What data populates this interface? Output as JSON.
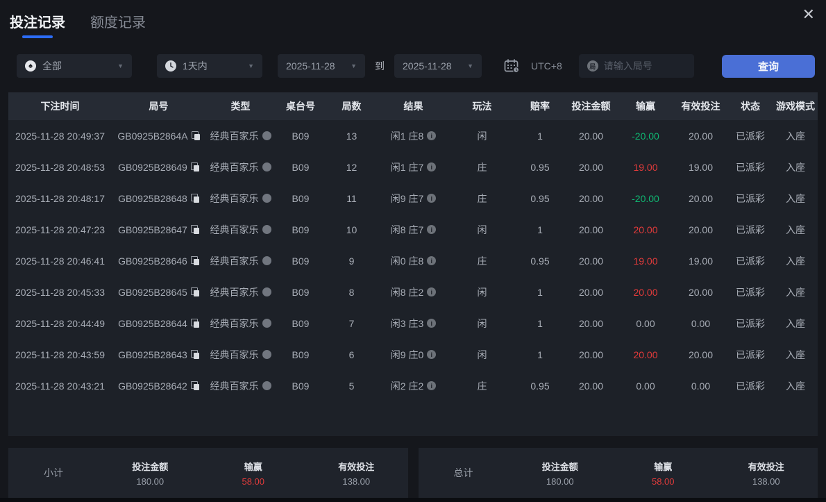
{
  "window": {
    "close_glyph": "✕"
  },
  "tabs": [
    {
      "label": "投注记录",
      "active": true
    },
    {
      "label": "额度记录",
      "active": false
    }
  ],
  "filters": {
    "game_type": "全部",
    "time_range": "1天内",
    "date_from": "2025-11-28",
    "to_label": "到",
    "date_to": "2025-11-28",
    "timezone": "UTC+8",
    "round_input_placeholder": "请输入局号",
    "round_badge_glyph": "局",
    "search_label": "查询",
    "caret_glyph": "▼",
    "spade_glyph": "♠"
  },
  "table": {
    "columns": [
      "下注时间",
      "局号",
      "类型",
      "桌台号",
      "局数",
      "结果",
      "玩法",
      "赔率",
      "投注金额",
      "输赢",
      "有效投注",
      "状态",
      "游戏模式"
    ],
    "info_glyph": "i",
    "rows": [
      {
        "time": "2025-11-28 20:49:37",
        "round_id": "GB0925B2864A",
        "type": "经典百家乐",
        "table_no": "B09",
        "round_no": "13",
        "result": "闲1 庄8",
        "play": "闲",
        "odds": "1",
        "bet": "20.00",
        "winloss": "-20.00",
        "winloss_color": "green",
        "valid": "20.00",
        "status": "已派彩",
        "mode": "入座"
      },
      {
        "time": "2025-11-28 20:48:53",
        "round_id": "GB0925B28649",
        "type": "经典百家乐",
        "table_no": "B09",
        "round_no": "12",
        "result": "闲1 庄7",
        "play": "庄",
        "odds": "0.95",
        "bet": "20.00",
        "winloss": "19.00",
        "winloss_color": "red",
        "valid": "19.00",
        "status": "已派彩",
        "mode": "入座"
      },
      {
        "time": "2025-11-28 20:48:17",
        "round_id": "GB0925B28648",
        "type": "经典百家乐",
        "table_no": "B09",
        "round_no": "11",
        "result": "闲9 庄7",
        "play": "庄",
        "odds": "0.95",
        "bet": "20.00",
        "winloss": "-20.00",
        "winloss_color": "green",
        "valid": "20.00",
        "status": "已派彩",
        "mode": "入座"
      },
      {
        "time": "2025-11-28 20:47:23",
        "round_id": "GB0925B28647",
        "type": "经典百家乐",
        "table_no": "B09",
        "round_no": "10",
        "result": "闲8 庄7",
        "play": "闲",
        "odds": "1",
        "bet": "20.00",
        "winloss": "20.00",
        "winloss_color": "red",
        "valid": "20.00",
        "status": "已派彩",
        "mode": "入座"
      },
      {
        "time": "2025-11-28 20:46:41",
        "round_id": "GB0925B28646",
        "type": "经典百家乐",
        "table_no": "B09",
        "round_no": "9",
        "result": "闲0 庄8",
        "play": "庄",
        "odds": "0.95",
        "bet": "20.00",
        "winloss": "19.00",
        "winloss_color": "red",
        "valid": "19.00",
        "status": "已派彩",
        "mode": "入座"
      },
      {
        "time": "2025-11-28 20:45:33",
        "round_id": "GB0925B28645",
        "type": "经典百家乐",
        "table_no": "B09",
        "round_no": "8",
        "result": "闲8 庄2",
        "play": "闲",
        "odds": "1",
        "bet": "20.00",
        "winloss": "20.00",
        "winloss_color": "red",
        "valid": "20.00",
        "status": "已派彩",
        "mode": "入座"
      },
      {
        "time": "2025-11-28 20:44:49",
        "round_id": "GB0925B28644",
        "type": "经典百家乐",
        "table_no": "B09",
        "round_no": "7",
        "result": "闲3 庄3",
        "play": "闲",
        "odds": "1",
        "bet": "20.00",
        "winloss": "0.00",
        "winloss_color": "plain",
        "valid": "0.00",
        "status": "已派彩",
        "mode": "入座"
      },
      {
        "time": "2025-11-28 20:43:59",
        "round_id": "GB0925B28643",
        "type": "经典百家乐",
        "table_no": "B09",
        "round_no": "6",
        "result": "闲9 庄0",
        "play": "闲",
        "odds": "1",
        "bet": "20.00",
        "winloss": "20.00",
        "winloss_color": "red",
        "valid": "20.00",
        "status": "已派彩",
        "mode": "入座"
      },
      {
        "time": "2025-11-28 20:43:21",
        "round_id": "GB0925B28642",
        "type": "经典百家乐",
        "table_no": "B09",
        "round_no": "5",
        "result": "闲2 庄2",
        "play": "庄",
        "odds": "0.95",
        "bet": "20.00",
        "winloss": "0.00",
        "winloss_color": "plain",
        "valid": "0.00",
        "status": "已派彩",
        "mode": "入座"
      }
    ]
  },
  "summary": {
    "labels": {
      "bet": "投注金额",
      "winloss": "输赢",
      "valid": "有效投注"
    },
    "subtotal": {
      "label": "小计",
      "bet": "180.00",
      "winloss": "58.00",
      "valid": "138.00"
    },
    "total": {
      "label": "总计",
      "bet": "180.00",
      "winloss": "58.00",
      "valid": "138.00"
    }
  },
  "colors": {
    "accent_blue": "#4a6fd6",
    "tab_underline_blue": "#2c6cf6",
    "win_red": "#e23b3b",
    "loss_green": "#0fb973",
    "page_bg": "#15171c",
    "table_header_bg": "#262b34",
    "table_body_bg": "#1d2128",
    "panel_bg": "#1f232b"
  }
}
